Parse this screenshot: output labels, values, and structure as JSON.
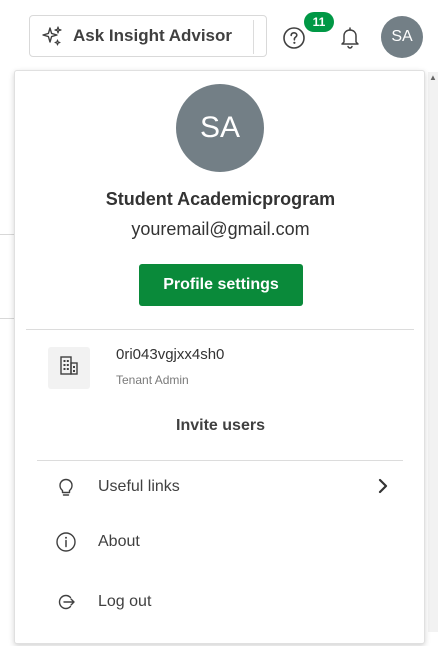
{
  "toolbar": {
    "insight_advisor_label": "Ask Insight Advisor",
    "notification_count": "11",
    "user_initials": "SA"
  },
  "profile": {
    "initials": "SA",
    "name": "Student Academicprogram",
    "email": "youremail@gmail.com",
    "settings_button_label": "Profile settings"
  },
  "tenant": {
    "id": "0ri043vgjxx4sh0",
    "role": "Tenant Admin"
  },
  "invite_users_label": "Invite users",
  "menu": {
    "items": [
      {
        "label": "Useful links",
        "icon": "lightbulb-icon",
        "has_submenu": true
      },
      {
        "label": "About",
        "icon": "info-icon",
        "has_submenu": false
      },
      {
        "label": "Log out",
        "icon": "logout-icon",
        "has_submenu": false
      }
    ]
  },
  "colors": {
    "accent_green": "#009845",
    "button_green": "#0a8a3a",
    "avatar_gray": "#737f86"
  }
}
